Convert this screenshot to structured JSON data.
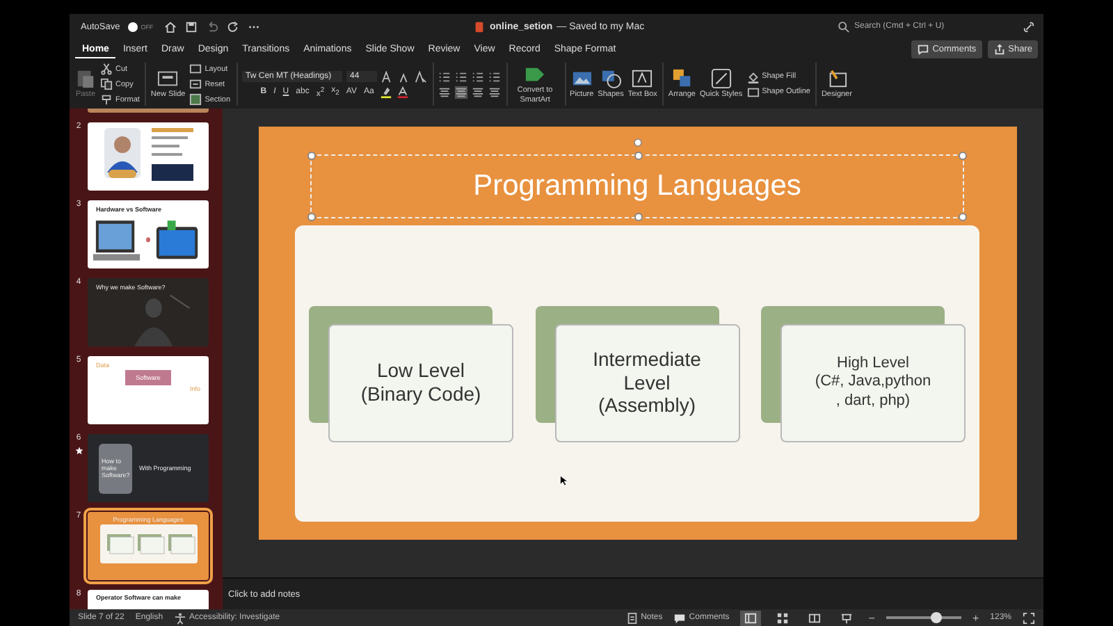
{
  "title_bar": {
    "autosave": "AutoSave",
    "autosave_on": false,
    "autosave_state": "OFF",
    "document": "online_setion",
    "status": "— Saved to my Mac",
    "search_placeholder": "Search (Cmd + Ctrl + U)"
  },
  "tabs": [
    {
      "label": "Home",
      "selected": true
    },
    {
      "label": "Insert",
      "selected": false
    },
    {
      "label": "Draw",
      "selected": false
    },
    {
      "label": "Design",
      "selected": false
    },
    {
      "label": "Transitions",
      "selected": false
    },
    {
      "label": "Animations",
      "selected": false
    },
    {
      "label": "Slide Show",
      "selected": false
    },
    {
      "label": "Review",
      "selected": false
    },
    {
      "label": "View",
      "selected": false
    },
    {
      "label": "Record",
      "selected": false
    },
    {
      "label": "Shape Format",
      "selected": false
    }
  ],
  "comments_button": "Comments",
  "share_button": "Share",
  "ribbon": {
    "paste": "Paste",
    "cut": "Cut",
    "copy": "Copy",
    "format": "Format",
    "new_slide": "New Slide",
    "layout": "Layout",
    "reset": "Reset",
    "section": "Section",
    "font_name": "Tw Cen MT (Headings)",
    "font_size": "44",
    "format_buttons": [
      "B",
      "I",
      "U",
      "abc",
      "x$^{2}$",
      "x$_{2}$",
      "AV",
      "Aa"
    ],
    "smartart": "Convert to SmartArt",
    "picture": "Picture",
    "shapes": "Shapes",
    "text_box": "Text Box",
    "arrange": "Arrange",
    "quick_styles": "Quick Styles",
    "shape_fill": "Shape Fill",
    "shape_outline": "Shape Outline",
    "designer": "Designer"
  },
  "thumbnails": [
    {
      "number": "2",
      "selected": false,
      "starred": false
    },
    {
      "number": "3",
      "kind": "devices",
      "texts": [
        "Hardware vs Software"
      ],
      "selected": false,
      "starred": false
    },
    {
      "number": "4",
      "kind": "dark",
      "texts": [
        "Why we make Software?"
      ],
      "selected": false,
      "starred": false
    },
    {
      "number": "5",
      "kind": "diagram",
      "texts": [
        "Data",
        "Software",
        "Info"
      ],
      "selected": false,
      "starred": false
    },
    {
      "number": "6",
      "kind": "laptop",
      "texts": [
        "How to make Software?",
        "With Programming"
      ],
      "selected": false,
      "starred": true
    },
    {
      "number": "7",
      "kind": "current",
      "texts": [
        "Programming Languages"
      ],
      "selected": true,
      "starred": false
    },
    {
      "number": "8",
      "kind": "text",
      "texts": [
        "Operator Software can make"
      ],
      "selected": false,
      "starred": false
    }
  ],
  "slide": {
    "title": "Programming Languages",
    "title_selected": true,
    "cards": [
      {
        "lines": [
          "Low Level",
          "(Binary Code)"
        ]
      },
      {
        "lines": [
          "Intermediate",
          "Level",
          "(Assembly)"
        ]
      },
      {
        "lines": [
          "High Level",
          "(C#, Java,python",
          ", dart, php)"
        ]
      }
    ]
  },
  "notes_placeholder": "Click to add notes",
  "status_bar": {
    "slide": "Slide 7 of 22",
    "language": "English",
    "accessibility": "Accessibility: Investigate",
    "notes": "Notes",
    "comments": "Comments",
    "zoom_out": "−",
    "zoom_slider": {
      "level": 0.67
    },
    "zoom_in": "+",
    "zoom": "123%"
  }
}
